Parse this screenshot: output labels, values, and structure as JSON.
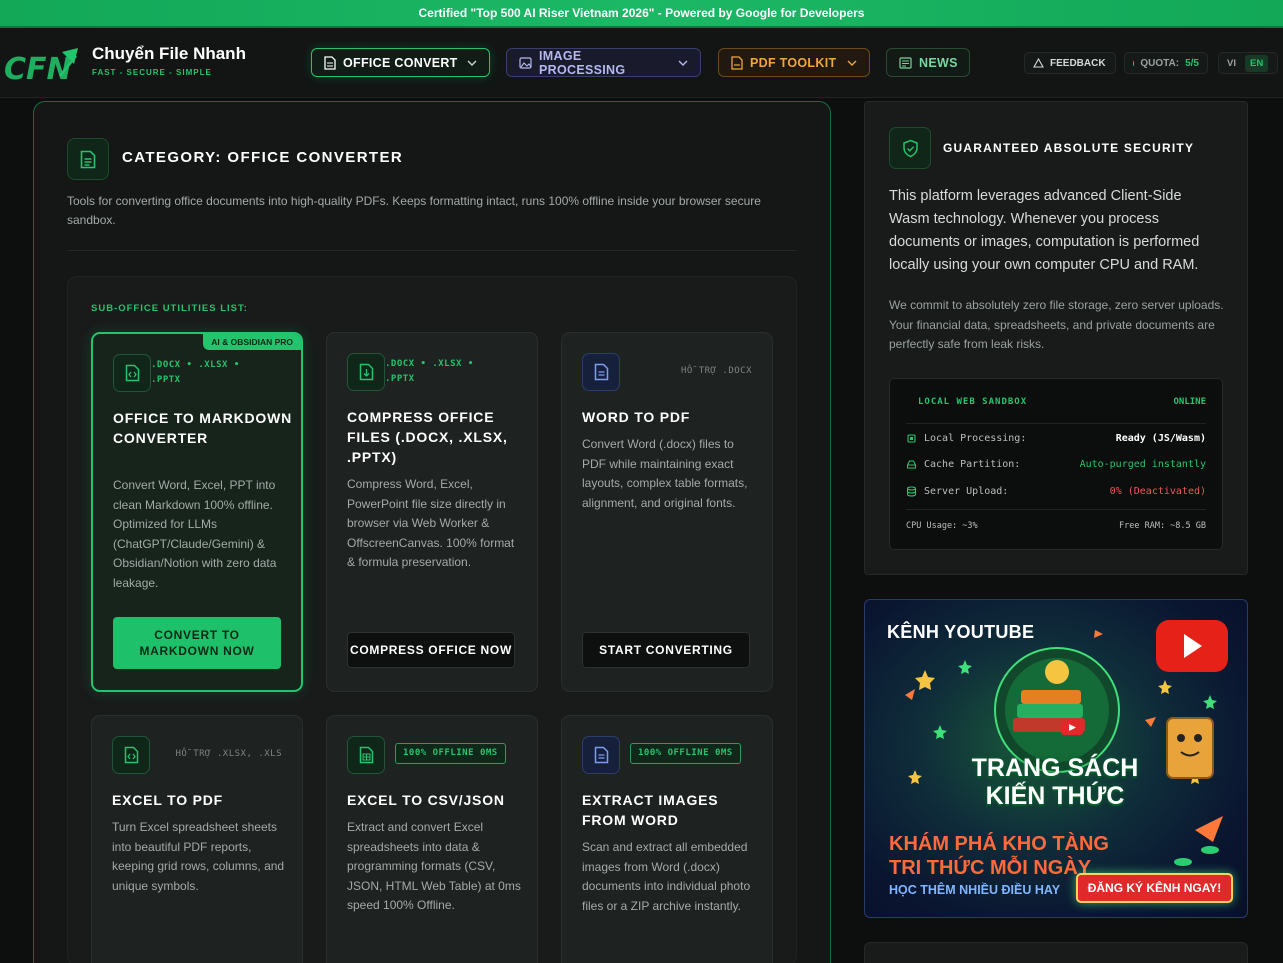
{
  "banner": {
    "text": "Certified \"Top 500 AI Riser Vietnam 2026\" - Powered by Google for Developers"
  },
  "header": {
    "brand_name": "Chuyển File Nhanh",
    "brand_tagline": "FAST - SECURE - SIMPLE",
    "nav": [
      {
        "label": "OFFICE CONVERT",
        "icon": "document-icon",
        "active": true
      },
      {
        "label": "IMAGE PROCESSING",
        "icon": "image-icon",
        "active": false
      },
      {
        "label": "PDF TOOLKIT",
        "icon": "pdf-file-icon",
        "active": false
      },
      {
        "label": "NEWS",
        "icon": "newspaper-icon",
        "active": false
      }
    ],
    "feedback_label": "FEEDBACK",
    "quota_label": "QUOTA:",
    "quota_value": "5/5",
    "lang_vi": "VI",
    "lang_en": "EN",
    "lang_active": "EN"
  },
  "category": {
    "title": "CATEGORY: OFFICE CONVERTER",
    "description": "Tools for converting office documents into high-quality PDFs. Keeps formatting intact, runs 100% offline inside your browser secure sandbox.",
    "sub_label": "SUB-OFFICE UTILITIES LIST:"
  },
  "tools": [
    {
      "badge": "AI & OBSIDIAN PRO",
      "formats": ".DOCX • .XLSX • .PPTX",
      "title": "OFFICE TO MARKDOWN CONVERTER",
      "description": "Convert Word, Excel, PPT into clean Markdown 100% offline. Optimized for LLMs (ChatGPT/Claude/Gemini) & Obsidian/Notion with zero data leakage.",
      "button": "CONVERT TO MARKDOWN NOW"
    },
    {
      "formats": ".DOCX • .XLSX • .PPTX",
      "title": "COMPRESS OFFICE FILES (.DOCX, .XLSX, .PPTX)",
      "description": "Compress Word, Excel, PowerPoint file size directly in browser via Web Worker & OffscreenCanvas. 100% format & formula preservation.",
      "button": "COMPRESS OFFICE NOW"
    },
    {
      "formats": "HỖ TRỢ .DOCX",
      "title": "WORD TO PDF",
      "description": "Convert Word (.docx) files to PDF while maintaining exact layouts, complex table formats, alignment, and original fonts.",
      "button": "START CONVERTING"
    },
    {
      "formats": "HỖ TRỢ .XLSX, .XLS",
      "title": "EXCEL TO PDF",
      "description": "Turn Excel spreadsheet sheets into beautiful PDF reports, keeping grid rows, columns, and unique symbols."
    },
    {
      "formats": "100% OFFLINE 0MS",
      "title": "EXCEL TO CSV/JSON",
      "description": "Extract and convert Excel spreadsheets into data & programming formats (CSV, JSON, HTML Web Table) at 0ms speed 100% Offline."
    },
    {
      "formats": "100% OFFLINE 0MS",
      "title": "EXTRACT IMAGES FROM WORD",
      "description": "Scan and extract all embedded images from Word (.docx) documents into individual photo files or a ZIP archive instantly."
    }
  ],
  "security": {
    "title": "GUARANTEED ABSOLUTE SECURITY",
    "paragraph1": "This platform leverages advanced Client-Side Wasm technology. Whenever you process documents or images, computation is performed locally using your own computer CPU and RAM.",
    "paragraph2": "We commit to absolutely zero file storage, zero server uploads. Your financial data, spreadsheets, and private documents are perfectly safe from leak risks.",
    "sandbox": {
      "header": "LOCAL WEB SANDBOX",
      "status": "ONLINE",
      "rows": [
        {
          "icon": "cpu-icon",
          "label": "Local Processing:",
          "value": "Ready (JS/Wasm)"
        },
        {
          "icon": "drive-icon",
          "label": "Cache Partition:",
          "value": "Auto-purged instantly"
        },
        {
          "icon": "database-icon",
          "label": "Server Upload:",
          "value": "0% (Deactivated)"
        }
      ],
      "cpu_usage": "CPU Usage: ~3%",
      "free_ram": "Free RAM: ~8.5 GB"
    }
  },
  "youtube_banner": {
    "kenh": "KÊNH YOUTUBE",
    "title_line1": "TRANG SÁCH",
    "title_line2": "KIẾN THỨC",
    "discover_line1": "KHÁM PHÁ KHO TÀNG",
    "discover_line2": "TRI THỨC MỖI NGÀY",
    "sub": "HỌC THÊM NHIỀU ĐIỀU HAY",
    "button": "ĐĂNG KÝ KÊNH NGAY!"
  },
  "colors": {
    "accent": "#23c46d",
    "background": "#0d0f0e",
    "danger": "#f05757",
    "pdf_orange": "#f0a63b"
  }
}
